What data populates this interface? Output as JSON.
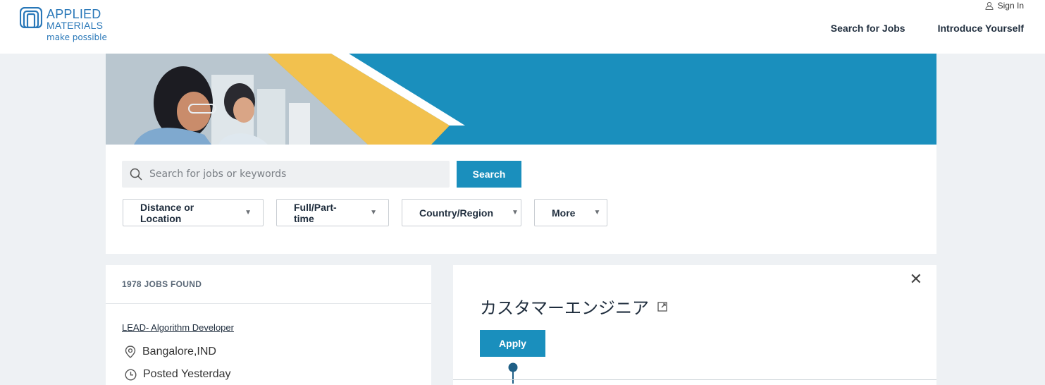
{
  "header": {
    "logo": {
      "line1": "APPLIED",
      "line2": "MATERIALS",
      "tagline": "make possible",
      "brand_color": "#2877b8"
    },
    "sign_in": "Sign In",
    "nav": [
      "Search for Jobs",
      "Introduce Yourself"
    ]
  },
  "hero": {
    "image": "lab-researchers-photo",
    "colors": {
      "blue": "#1a8fbd",
      "yellow": "#f2c14e"
    }
  },
  "search": {
    "placeholder": "Search for jobs or keywords",
    "button_label": "Search",
    "filters": [
      {
        "label": "Distance or Location"
      },
      {
        "label": "Full/Part-time"
      },
      {
        "label": "Country/Region"
      },
      {
        "label": "More"
      }
    ]
  },
  "results": {
    "count_label": "1978 JOBS FOUND",
    "jobs": [
      {
        "title": "LEAD- Algorithm Developer",
        "location": "Bangalore,IND",
        "posted": "Posted Yesterday"
      }
    ]
  },
  "detail": {
    "title": "カスタマーエンジニア",
    "apply_label": "Apply",
    "close_icon": "close-icon",
    "external_icon": "external-link-icon"
  }
}
